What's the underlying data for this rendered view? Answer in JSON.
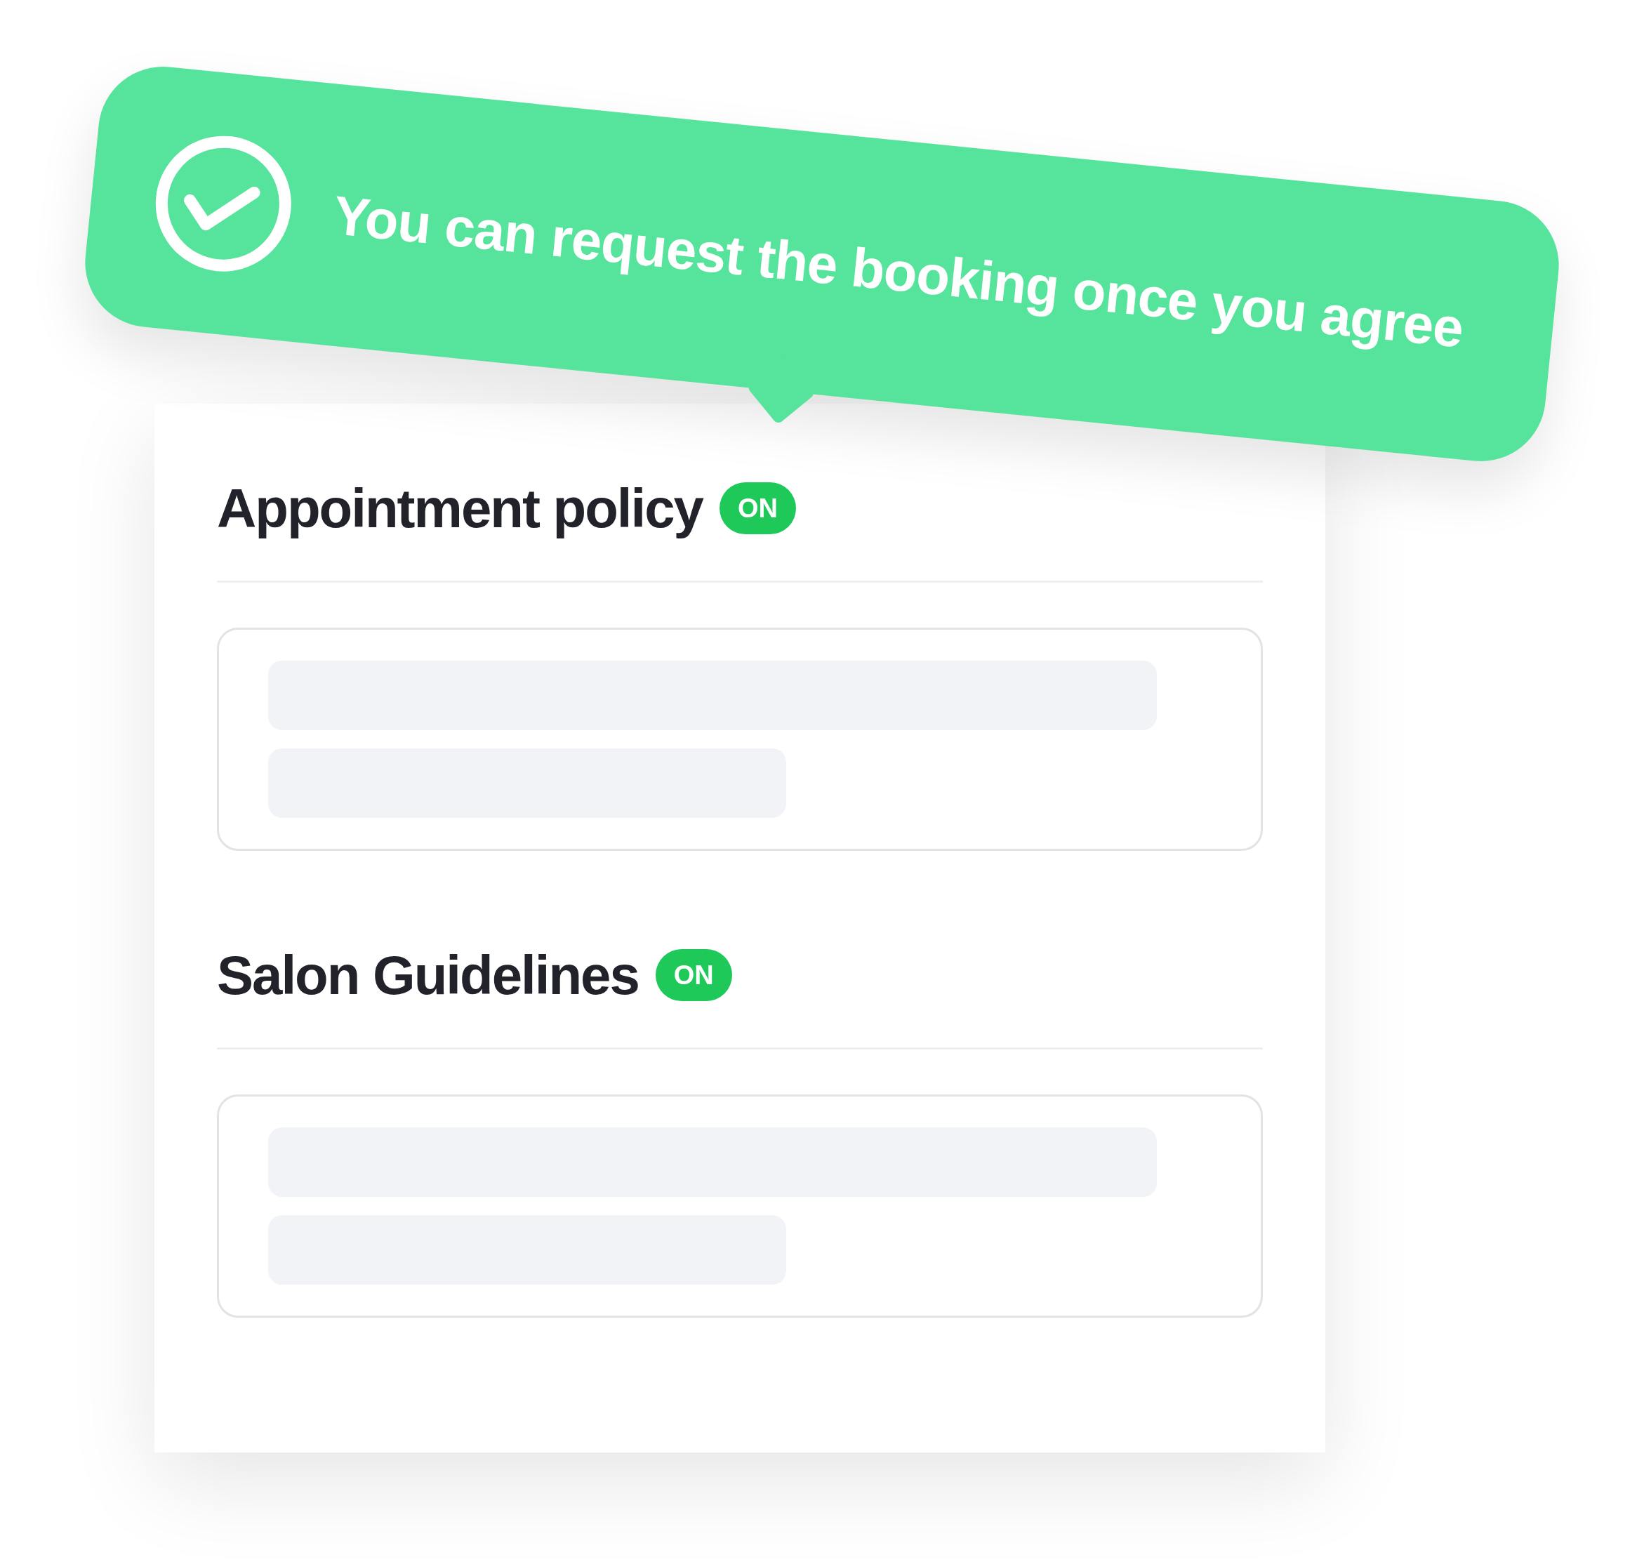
{
  "banner": {
    "message": "You can request the booking once you agree"
  },
  "sections": [
    {
      "title": "Appointment policy",
      "badge": "ON",
      "on": true
    },
    {
      "title": "Salon Guidelines",
      "badge": "ON",
      "on": true
    }
  ]
}
